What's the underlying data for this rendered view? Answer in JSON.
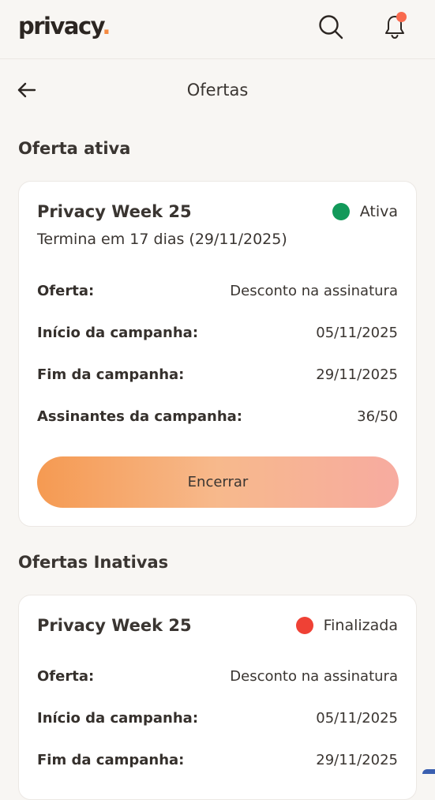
{
  "app": {
    "logo_text": "privacy",
    "logo_dot": ".",
    "accent_color": "#f58a40",
    "notification_dot_color": "#f96a4e"
  },
  "header": {
    "icons": [
      "search-icon",
      "bell-icon"
    ]
  },
  "subheader": {
    "back_icon": "arrow-left-icon",
    "title": "Ofertas"
  },
  "active_section": {
    "title": "Oferta ativa",
    "card": {
      "name": "Privacy Week 25",
      "status": "Ativa",
      "status_color": "#12995a",
      "subtitle": "Termina em 17 dias (29/11/2025)",
      "rows": [
        {
          "label": "Oferta:",
          "value": "Desconto na assinatura"
        },
        {
          "label": "Início da campanha:",
          "value": "05/11/2025"
        },
        {
          "label": "Fim da campanha:",
          "value": "29/11/2025"
        },
        {
          "label": "Assinantes da campanha:",
          "value": "36/50"
        }
      ],
      "button_label": "Encerrar"
    }
  },
  "inactive_section": {
    "title": "Ofertas Inativas",
    "card": {
      "name": "Privacy Week 25",
      "status": "Finalizada",
      "status_color": "#ef4135",
      "rows": [
        {
          "label": "Oferta:",
          "value": "Desconto na assinatura"
        },
        {
          "label": "Início da campanha:",
          "value": "05/11/2025"
        },
        {
          "label": "Fim da campanha:",
          "value": "29/11/2025"
        }
      ]
    }
  }
}
